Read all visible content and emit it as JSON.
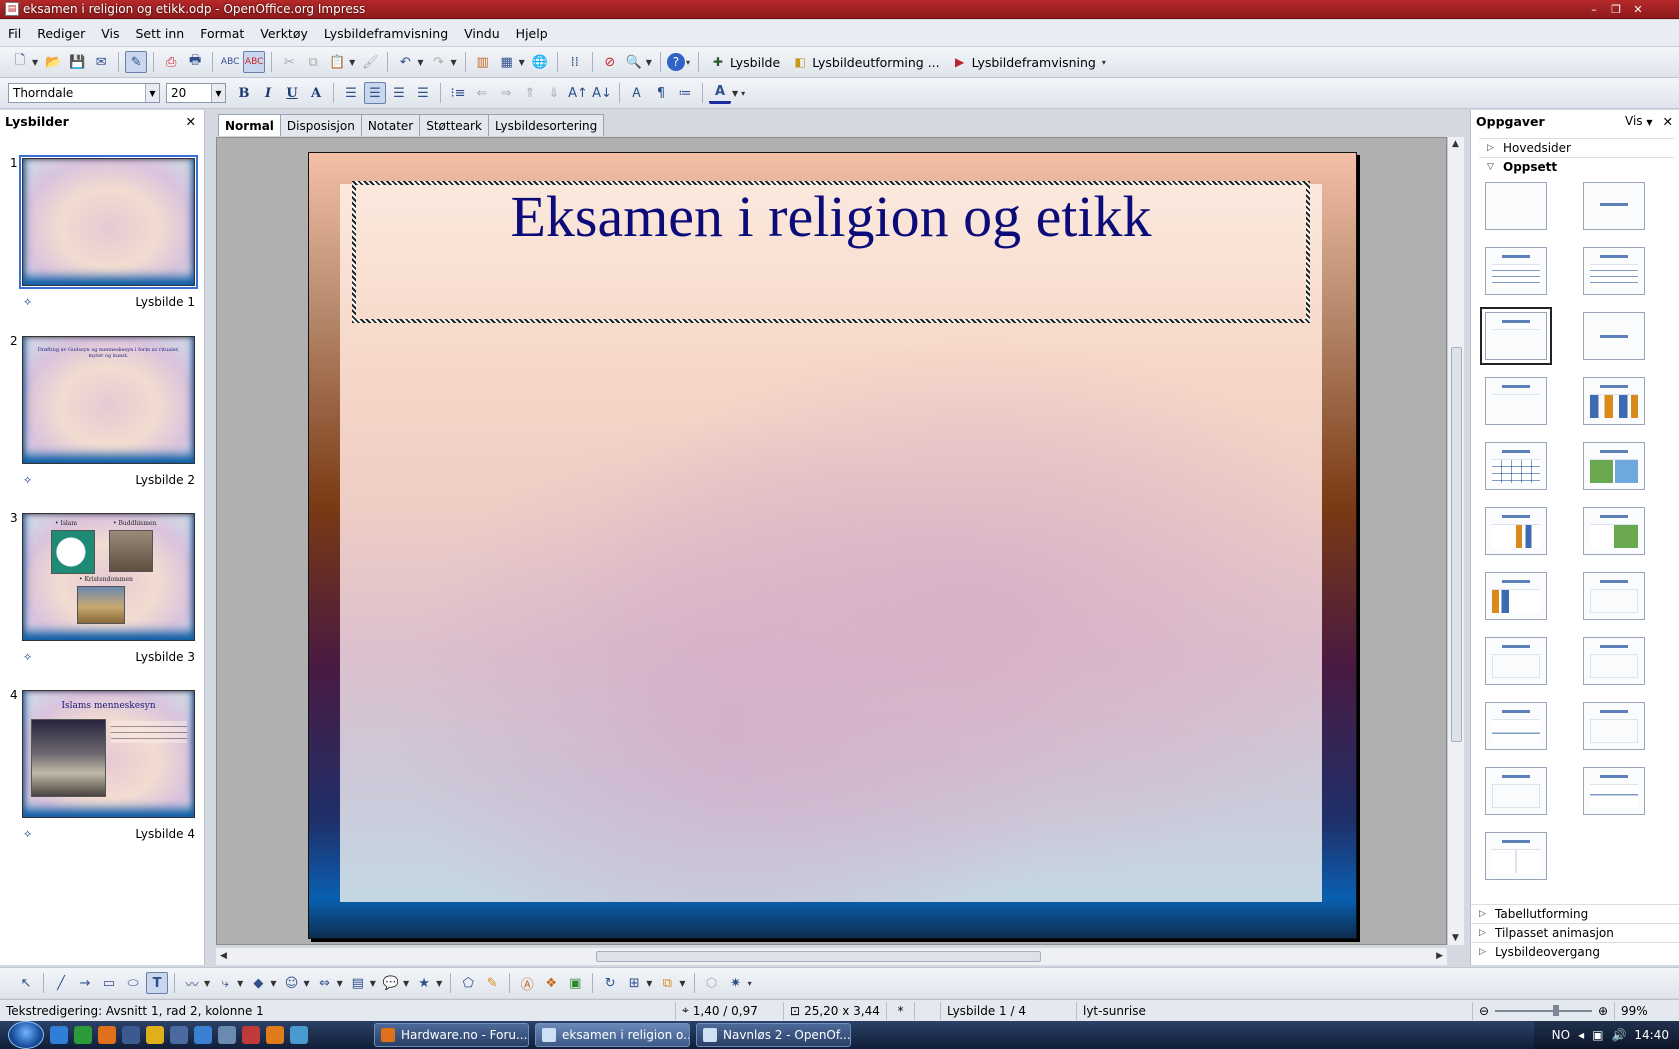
{
  "window": {
    "title": "eksamen i religion og etikk.odp - OpenOffice.org Impress",
    "controls": [
      "–",
      "❐",
      "✕"
    ]
  },
  "menu": [
    "Fil",
    "Rediger",
    "Vis",
    "Sett inn",
    "Format",
    "Verktøy",
    "Lysbildeframvisning",
    "Vindu",
    "Hjelp"
  ],
  "toolbar": {
    "slide_label": "Lysbilde",
    "slide_design_label": "Lysbildeutforming ...",
    "slideshow_label": "Lysbildeframvisning",
    "font_name": "Thorndale",
    "font_size": "20"
  },
  "slides_panel": {
    "title": "Lysbilder",
    "close": "✕",
    "slides": [
      {
        "num": "1",
        "label": "Lysbilde 1"
      },
      {
        "num": "2",
        "label": "Lysbilde 2",
        "text": "Drøfting av Gudssyn og menneskesyn i form av ritualer, myter og kunst."
      },
      {
        "num": "3",
        "label": "Lysbilde 3",
        "items": [
          "• Islam",
          "• Buddhismen",
          "• Kristendommen"
        ]
      },
      {
        "num": "4",
        "label": "Lysbilde 4",
        "title": "Islams menneskesyn"
      }
    ]
  },
  "view_tabs": [
    "Normal",
    "Disposisjon",
    "Notater",
    "Støtteark",
    "Lysbildesortering"
  ],
  "slide": {
    "title": "Eksamen i religion og etikk"
  },
  "task_pane": {
    "title": "Oppgaver",
    "view_label": "Vis",
    "close": "✕",
    "sections_top": [
      {
        "label": "Hovedsider",
        "open": false
      },
      {
        "label": "Oppsett",
        "open": true
      }
    ],
    "sections_bottom": [
      {
        "label": "Tabellutforming"
      },
      {
        "label": "Tilpasset animasjon"
      },
      {
        "label": "Lysbildeovergang"
      }
    ]
  },
  "status": {
    "mode": "Tekstredigering: Avsnitt 1, rad 2, kolonne 1",
    "position": "1,40 / 0,97",
    "size": "25,20 x 3,44",
    "modified": "*",
    "slide": "Lysbilde 1 / 4",
    "design": "lyt-sunrise",
    "zoom": "99%"
  },
  "taskbar": {
    "buttons": [
      "Hardware.no - Foru...",
      "eksamen i religion o...",
      "Navnløs 2 - OpenOf..."
    ],
    "lang": "NO",
    "time": "14:40"
  }
}
